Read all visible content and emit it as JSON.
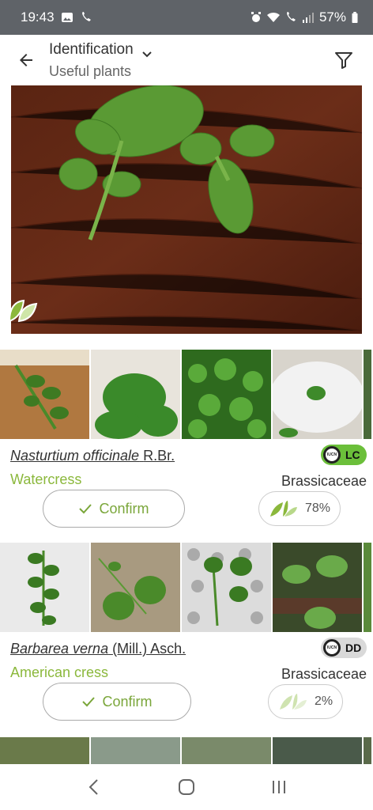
{
  "status_bar": {
    "time": "19:43",
    "battery": "57%"
  },
  "header": {
    "title": "Identification",
    "subtitle": "Useful plants",
    "icons": [
      "back-arrow-icon",
      "chevron-down-icon",
      "filter-icon"
    ]
  },
  "results": [
    {
      "genus_species": "Nasturtium officinale",
      "author": "R.Br.",
      "common_name": "Watercress",
      "family": "Brassicaceae",
      "iucn_code": "LC",
      "iucn_label": "IUCN",
      "iucn_color": "#6bbf3a",
      "confirm_label": "Confirm",
      "score": "78%",
      "score_fraction": 0.78
    },
    {
      "genus_species": "Barbarea verna",
      "author": "(Mill.) Asch.",
      "common_name": "American cress",
      "family": "Brassicaceae",
      "iucn_code": "DD",
      "iucn_label": "IUCN",
      "iucn_color": "#d9d9d9",
      "confirm_label": "Confirm",
      "score": "2%",
      "score_fraction": 0.02
    }
  ],
  "colors": {
    "accent_green": "#8bb83c",
    "status_bar": "#5f6368"
  }
}
